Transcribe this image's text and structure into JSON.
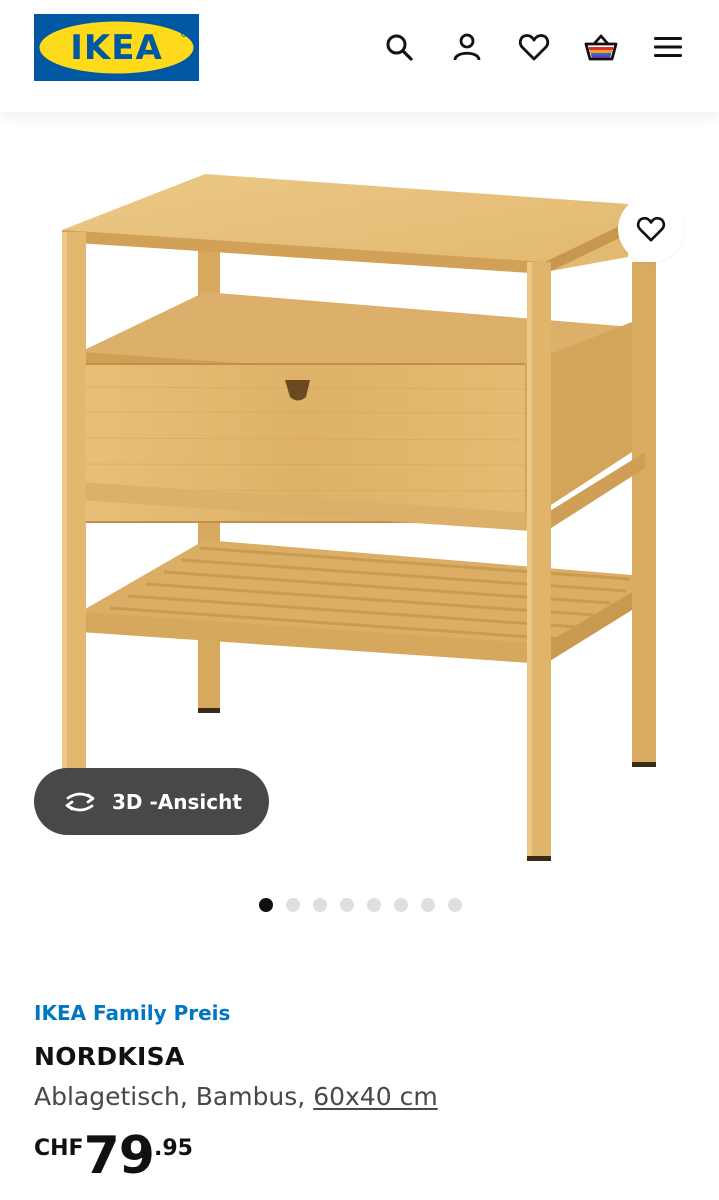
{
  "header": {
    "logo_text": "IKEA",
    "icons": [
      "search-icon",
      "account-icon",
      "favourites-icon",
      "shopping-bag-icon",
      "menu-icon"
    ]
  },
  "gallery": {
    "view3d_label": "3D -Ansicht",
    "image_count": 8,
    "active_index": 0
  },
  "product": {
    "family_price_label": "IKEA Family Preis",
    "name": "NORDKISA",
    "description": "Ablagetisch, Bambus, ",
    "measurement": "60x40 cm",
    "price_currency": "CHF",
    "price_integer": "79",
    "price_decimal": ".95"
  },
  "colors": {
    "ikea_blue": "#0058a3",
    "ikea_yellow": "#ffda1a",
    "family_blue": "#0077c1",
    "button_dark": "#484848",
    "bamboo": "#e2b66a"
  }
}
